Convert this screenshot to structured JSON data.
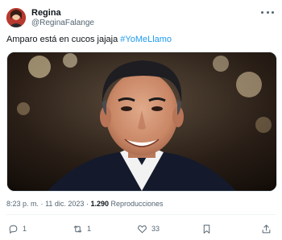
{
  "author": {
    "name": "Regina",
    "handle": "@ReginaFalange",
    "avatar_icon": "avatar-image"
  },
  "tweet": {
    "text": "Amparo está en cucos jajaja ",
    "hashtag": "#YoMeLlamo"
  },
  "media": {
    "description_icon": "photo-man-smiling"
  },
  "meta": {
    "time": "8:23 p. m.",
    "separator": "·",
    "date": "11 dic. 2023",
    "views_count": "1.290",
    "views_label": "Reproducciones"
  },
  "actions": {
    "reply_count": "1",
    "retweet_count": "1",
    "like_count": "33"
  },
  "colors": {
    "link": "#1d9bf0",
    "secondary_text": "#536471",
    "primary_text": "#0f1419"
  }
}
